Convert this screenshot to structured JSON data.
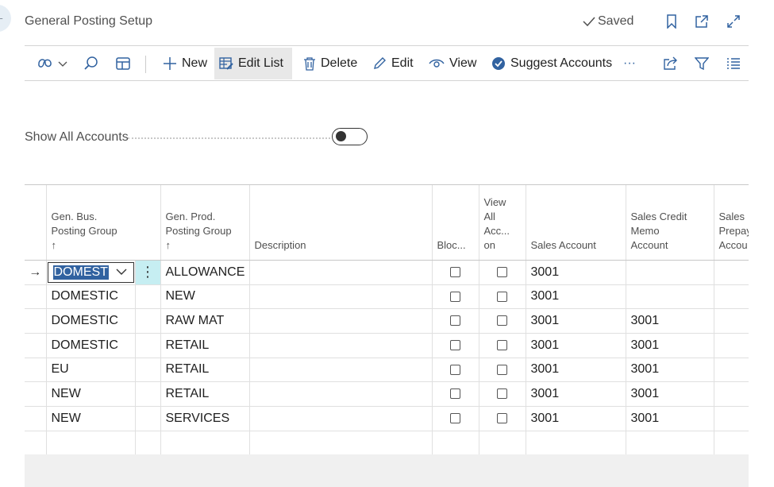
{
  "header": {
    "title": "General Posting Setup",
    "saved_label": "Saved"
  },
  "toolbar": {
    "new_label": "New",
    "edit_list_label": "Edit List",
    "delete_label": "Delete",
    "edit_label": "Edit",
    "view_label": "View",
    "suggest_label": "Suggest Accounts",
    "more_label": "···"
  },
  "filter": {
    "show_all_label": "Show All Accounts",
    "show_all_on": false
  },
  "table": {
    "headers": {
      "bus_group": [
        "Gen. Bus.",
        "Posting Group",
        "↑"
      ],
      "prod_group": [
        "Gen. Prod.",
        "Posting Group",
        "↑"
      ],
      "description": "Description",
      "blocked": "Bloc...",
      "view_all": [
        "View",
        "All",
        "Acc...",
        "on"
      ],
      "sales_account": "Sales Account",
      "sales_credit_memo": [
        "Sales Credit",
        "Memo",
        "Account"
      ],
      "sales_prepay": [
        "Sales",
        "Prepay",
        "Accou"
      ]
    },
    "rows": [
      {
        "bus": "DOMESTIC",
        "prod": "ALLOWANCE",
        "desc": "",
        "sales": "3001",
        "credit": ""
      },
      {
        "bus": "DOMESTIC",
        "prod": "NEW",
        "desc": "",
        "sales": "3001",
        "credit": ""
      },
      {
        "bus": "DOMESTIC",
        "prod": "RAW MAT",
        "desc": "",
        "sales": "3001",
        "credit": "3001"
      },
      {
        "bus": "DOMESTIC",
        "prod": "RETAIL",
        "desc": "",
        "sales": "3001",
        "credit": "3001"
      },
      {
        "bus": "EU",
        "prod": "RETAIL",
        "desc": "",
        "sales": "3001",
        "credit": "3001"
      },
      {
        "bus": "NEW",
        "prod": "RETAIL",
        "desc": "",
        "sales": "3001",
        "credit": "3001"
      },
      {
        "bus": "NEW",
        "prod": "SERVICES",
        "desc": "",
        "sales": "3001",
        "credit": "3001"
      }
    ],
    "editing_value": "DOMESTIC",
    "row_marker": "→",
    "cell_menu": "⋮"
  },
  "colors": {
    "accent": "#3162a0",
    "selected_cell": "#c6eef2",
    "toolbar_active": "#e8e8e8"
  }
}
